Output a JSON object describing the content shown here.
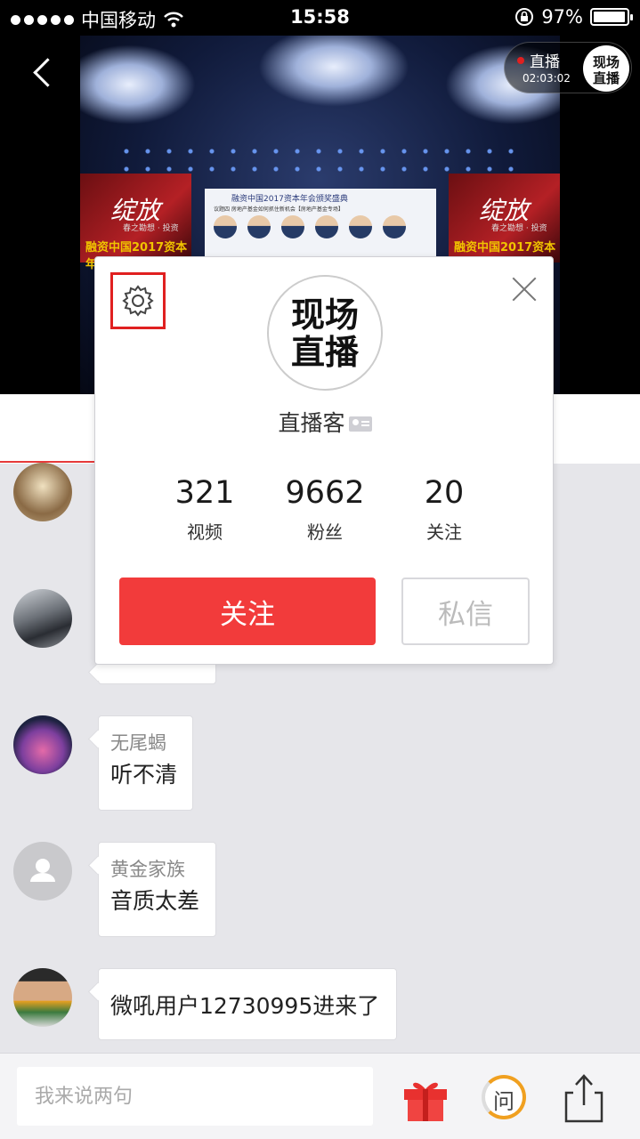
{
  "status_bar": {
    "carrier": "中国移动",
    "time": "15:58",
    "battery_percent": "97%"
  },
  "video": {
    "live_label": "直播",
    "live_duration": "02:03:02",
    "event_banner_title": "融资中国2017资本年会",
    "event_banner_art": "绽放",
    "event_banner_sub": "春之勘想 · 投资",
    "screen_title": "融资中国2017资本年会颁奖盛典",
    "screen_subtitle": "议题四 房地产基金如何抓住新机会【房地产基金专场】"
  },
  "chat": {
    "messages": [
      {
        "name": "无尾蝎",
        "text": "听不清"
      },
      {
        "name": "黄金家族",
        "text": "音质太差"
      },
      {
        "name": "",
        "text": "微吼用户12730995进来了"
      }
    ]
  },
  "profile_card": {
    "name": "直播客",
    "avatar_text": [
      "现场",
      "直播"
    ],
    "stats": [
      {
        "value": "321",
        "label": "视频"
      },
      {
        "value": "9662",
        "label": "粉丝"
      },
      {
        "value": "20",
        "label": "关注"
      }
    ],
    "follow_label": "关注",
    "message_label": "私信"
  },
  "bottom_bar": {
    "input_placeholder": "我来说两句",
    "ask_label": "问"
  },
  "colors": {
    "accent_red": "#f23b3b",
    "highlight_box": "#e02020",
    "ask_ring": "#f0a020"
  },
  "icons": [
    "back-icon",
    "wifi-icon",
    "lock-rotation-icon",
    "battery-icon",
    "settings-gear-icon",
    "close-icon",
    "id-card-icon",
    "gift-icon",
    "share-icon"
  ]
}
